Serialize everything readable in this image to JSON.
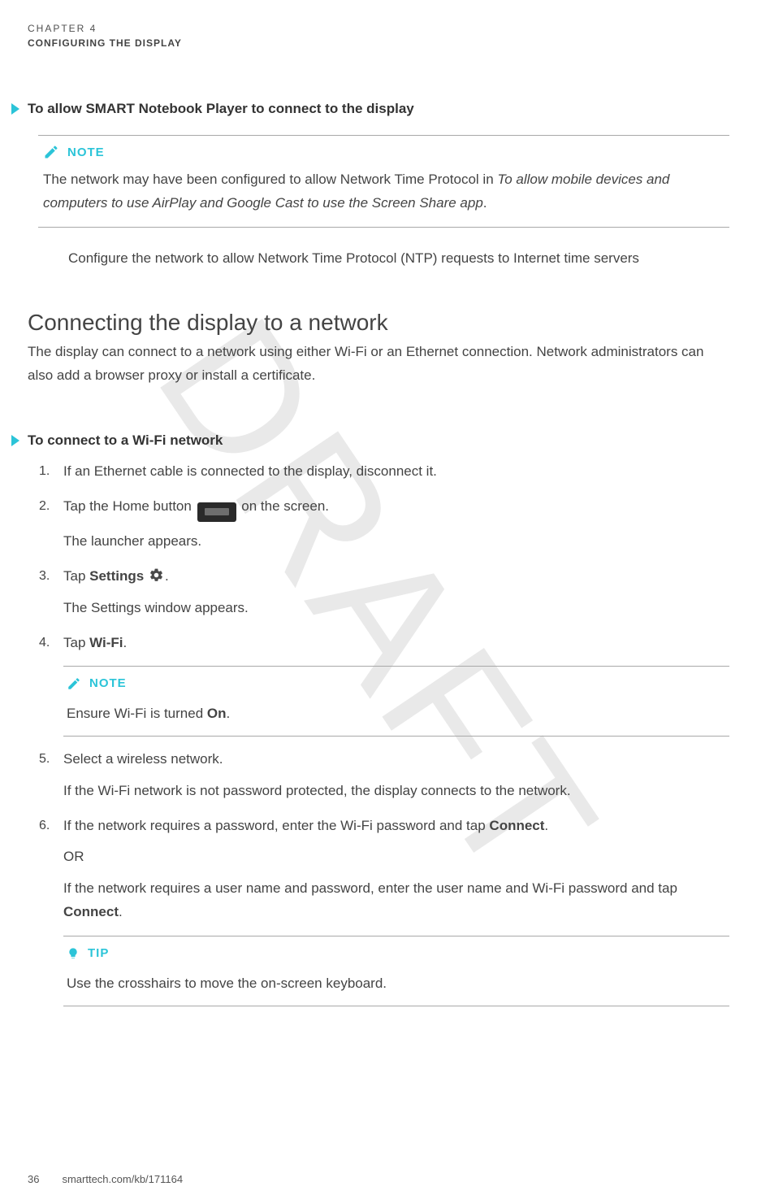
{
  "header": {
    "chapter_label": "CHAPTER 4",
    "chapter_title": "CONFIGURING THE DISPLAY"
  },
  "watermark": "DRAFT",
  "proc1": {
    "heading": "To allow SMART Notebook Player to connect to the display",
    "note_label": "NOTE",
    "note_before": "The network may have been configured to allow Network Time Protocol in ",
    "note_italic": "To allow mobile devices and computers to use AirPlay and Google Cast to use the Screen Share app",
    "note_after": ".",
    "line": "Configure the network to allow Network Time Protocol (NTP) requests to Internet time servers"
  },
  "section": {
    "title": "Connecting the display to a network",
    "lead": "The display can connect to a network using either Wi-Fi or an Ethernet connection. Network administrators can also add a browser proxy or install a certificate."
  },
  "proc2": {
    "heading": "To connect to a Wi-Fi network",
    "step1": "If an Ethernet cable is connected to the display, disconnect it.",
    "step2_before": "Tap the Home button ",
    "step2_after": " on the screen.",
    "step2_result": "The launcher appears.",
    "step3_before": "Tap ",
    "step3_bold": "Settings",
    "step3_after": " ",
    "step3_period": ".",
    "step3_result_before": "The ",
    "step3_result_italic": "Settings",
    "step3_result_after": " window appears.",
    "step4_before": "Tap ",
    "step4_bold": "Wi-Fi",
    "step4_after": ".",
    "step4_note_label": "NOTE",
    "step4_note_before": "Ensure Wi-Fi is turned ",
    "step4_note_bold": "On",
    "step4_note_after": ".",
    "step5_a": "Select a wireless network.",
    "step5_b": "If the Wi-Fi network is not password protected, the display connects to the network.",
    "step6_a_before": "If the network requires a password, enter the Wi-Fi password and tap ",
    "step6_a_bold": "Connect",
    "step6_a_after": ".",
    "step6_or": "OR",
    "step6_b_before": "If the network requires a user name and password, enter the user name and Wi-Fi password and tap ",
    "step6_b_bold": "Connect",
    "step6_b_after": ".",
    "tip_label": "TIP",
    "tip_body": "Use the crosshairs to move the on-screen keyboard."
  },
  "footer": {
    "page": "36",
    "url": "smarttech.com/kb/171164"
  }
}
